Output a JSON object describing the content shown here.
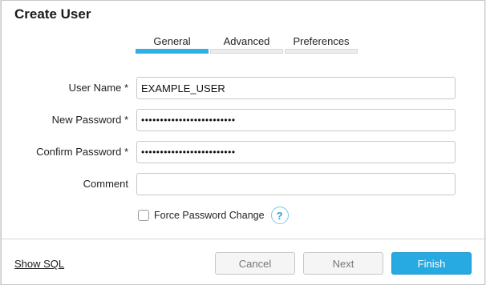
{
  "dialog": {
    "title": "Create User"
  },
  "tabs": [
    {
      "label": "General",
      "active": true
    },
    {
      "label": "Advanced",
      "active": false
    },
    {
      "label": "Preferences",
      "active": false
    }
  ],
  "form": {
    "user_name": {
      "label": "User Name",
      "required_mark": "*",
      "value": "EXAMPLE_USER"
    },
    "new_password": {
      "label": "New Password",
      "required_mark": "*",
      "value": "•••••••••••••••••••••••••"
    },
    "confirm_password": {
      "label": "Confirm Password",
      "required_mark": "*",
      "value": "•••••••••••••••••••••••••"
    },
    "comment": {
      "label": "Comment",
      "value": ""
    },
    "force_password_change": {
      "label": "Force Password Change",
      "checked": false
    },
    "help_label": "?"
  },
  "footer": {
    "show_sql": "Show SQL",
    "cancel": "Cancel",
    "next": "Next",
    "finish": "Finish"
  },
  "colors": {
    "accent": "#27a9e1",
    "tab_active": "#2eb0e4"
  }
}
